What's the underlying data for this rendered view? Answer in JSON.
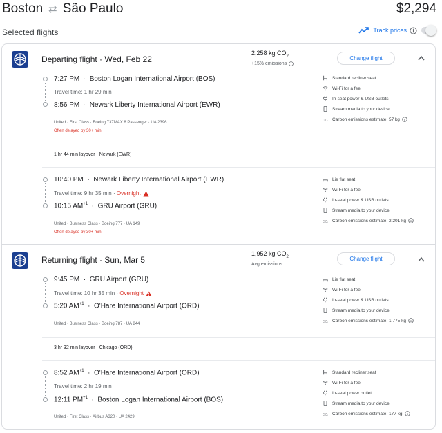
{
  "header": {
    "origin": "Boston",
    "destination": "São Paulo",
    "price": "$2,294"
  },
  "selected_label": "Selected flights",
  "track_prices_label": "Track prices",
  "change_flight_label": "Change flight",
  "departing": {
    "title": "Departing flight · Wed, Feb 22",
    "emissions": "2,258 kg CO",
    "emissions_sub": "2",
    "emissions_note": "+15% emissions",
    "seg1": {
      "dep_time": "7:27 PM",
      "dep_airport": "Boston Logan International Airport (BOS)",
      "travel_time": "Travel time: 1 hr 29 min",
      "arr_time": "8:56 PM",
      "arr_airport": "Newark Liberty International Airport (EWR)",
      "details": "United · First Class · Boeing 737MAX 8 Passenger · UA 2396",
      "delay": "Often delayed by 30+ min",
      "amenities": [
        "Standard recliner seat",
        "Wi-Fi for a fee",
        "In-seat power & USB outlets",
        "Stream media to your device",
        "Carbon emissions estimate: 57 kg"
      ]
    },
    "layover": "1 hr 44 min layover · Newark (EWR)",
    "seg2": {
      "dep_time": "10:40 PM",
      "dep_airport": "Newark Liberty International Airport (EWR)",
      "travel_time": "Travel time: 9 hr 35 min · ",
      "overnight": "Overnight",
      "arr_time": "10:15 AM",
      "arr_sup": "+1",
      "arr_airport": "GRU Airport (GRU)",
      "details": "United · Business Class · Boeing 777 · UA 149",
      "delay": "Often delayed by 30+ min",
      "amenities": [
        "Lie flat seat",
        "Wi-Fi for a fee",
        "In-seat power & USB outlets",
        "Stream media to your device",
        "Carbon emissions estimate: 2,201 kg"
      ]
    }
  },
  "returning": {
    "title": "Returning flight · Sun, Mar 5",
    "emissions": "1,952 kg CO",
    "emissions_sub": "2",
    "emissions_note": "Avg emissions",
    "seg1": {
      "dep_time": "9:45 PM",
      "dep_airport": "GRU Airport (GRU)",
      "travel_time": "Travel time: 10 hr 35 min · ",
      "overnight": "Overnight",
      "arr_time": "5:20 AM",
      "arr_sup": "+1",
      "arr_airport": "O'Hare International Airport (ORD)",
      "details": "United · Business Class · Boeing 787 · UA 844",
      "amenities": [
        "Lie flat seat",
        "Wi-Fi for a fee",
        "In-seat power & USB outlets",
        "Stream media to your device",
        "Carbon emissions estimate: 1,775 kg"
      ]
    },
    "layover": "3 hr 32 min layover · Chicago (ORD)",
    "seg2": {
      "dep_time": "8:52 AM",
      "dep_sup": "+1",
      "dep_airport": "O'Hare International Airport (ORD)",
      "travel_time": "Travel time: 2 hr 19 min",
      "arr_time": "12:11 PM",
      "arr_sup": "+1",
      "arr_airport": "Boston Logan International Airport (BOS)",
      "details": "United · First Class · Airbus A320 · UA 2429",
      "amenities": [
        "Standard recliner seat",
        "Wi-Fi for a fee",
        "In-seat power outlet",
        "Stream media to your device",
        "Carbon emissions estimate: 177 kg"
      ]
    }
  },
  "colors": {
    "accent": "#1a73e8",
    "warning": "#d93025",
    "united_blue": "#1b3f91"
  }
}
